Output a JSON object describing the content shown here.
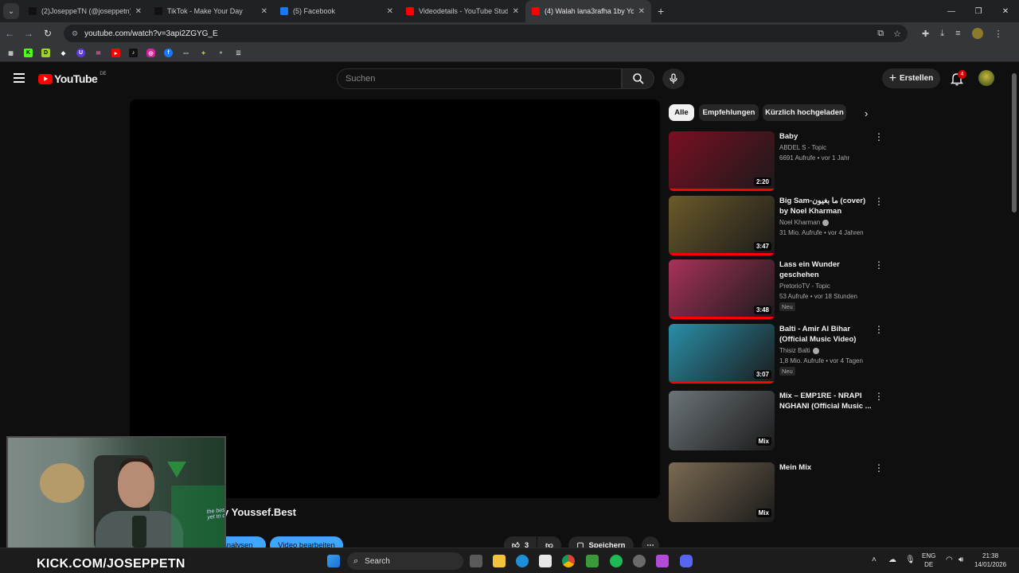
{
  "browser": {
    "tabs": [
      {
        "title": "(2)JoseppeTN (@joseppetn) | Ti",
        "color": "#111111",
        "active": false
      },
      {
        "title": "TikTok - Make Your Day",
        "color": "#111111",
        "active": false
      },
      {
        "title": "(5) Facebook",
        "color": "#1877f2",
        "active": false
      },
      {
        "title": "Videodetails - YouTube Studio",
        "color": "#ff0000",
        "active": false
      },
      {
        "title": "(4) Walah lana3rafha 1by Yousse",
        "color": "#ff0000",
        "active": true
      }
    ],
    "url": "youtube.com/watch?v=3api2ZGYG_E"
  },
  "youtube": {
    "logo_text": "YouTube",
    "country_code": "DE",
    "search_placeholder": "Suchen",
    "create_label": "Erstellen",
    "notification_count": "4",
    "video_title_partial": "y Youssef.Best",
    "buttons": {
      "analytics": "Analysen",
      "edit_video": "Video bearbeiten",
      "like_count": "3",
      "save": "Speichern"
    },
    "chips": [
      "Alle",
      "Empfehlungen",
      "Kürzlich hochgeladen"
    ],
    "recommendations": [
      {
        "title": "Baby",
        "channel": "ABDEL S - Topic",
        "stats": "6691 Aufrufe • vor 1 Jahr",
        "duration": "2:20",
        "badge": "",
        "thumb_color": "#7a0f22",
        "verified": false
      },
      {
        "title": "Big Sam-ما بغيون (cover) by Noel Kharman",
        "channel": "Noel Kharman",
        "stats": "31 Mio. Aufrufe • vor 4 Jahren",
        "duration": "3:47",
        "badge": "",
        "thumb_color": "#6b5a2a",
        "verified": true
      },
      {
        "title": "Lass ein Wunder geschehen",
        "channel": "PretorioTV - Topic",
        "stats": "53 Aufrufe • vor 18 Stunden",
        "duration": "3:48",
        "badge": "Neu",
        "thumb_color": "#a8325a",
        "verified": false
      },
      {
        "title": "Balti - Amir Al Bihar (Official Music Video)",
        "channel": "Thisiz Balti",
        "stats": "1,8 Mio. Aufrufe • vor 4 Tagen",
        "duration": "3:07",
        "badge": "Neu",
        "thumb_color": "#2a8fa8",
        "verified": true
      },
      {
        "title": "Mix – EMP1RE - NRAPI NGHANI (Official Music ...",
        "channel": "",
        "stats": "",
        "duration": "Mix",
        "badge": "",
        "thumb_color": "#6c7479",
        "verified": false
      },
      {
        "title": "Mein Mix",
        "channel": "",
        "stats": "",
        "duration": "Mix",
        "badge": "",
        "thumb_color": "#7a6a52",
        "verified": false
      }
    ]
  },
  "stream_overlay": {
    "kick_text": "KICK.COM/JOSEPPETN",
    "sign_text": "the best is yet to come"
  },
  "taskbar": {
    "search_label": "Search",
    "lang_top": "ENG",
    "lang_bottom": "DE",
    "time": "21:38",
    "date": "14/01/2026"
  }
}
